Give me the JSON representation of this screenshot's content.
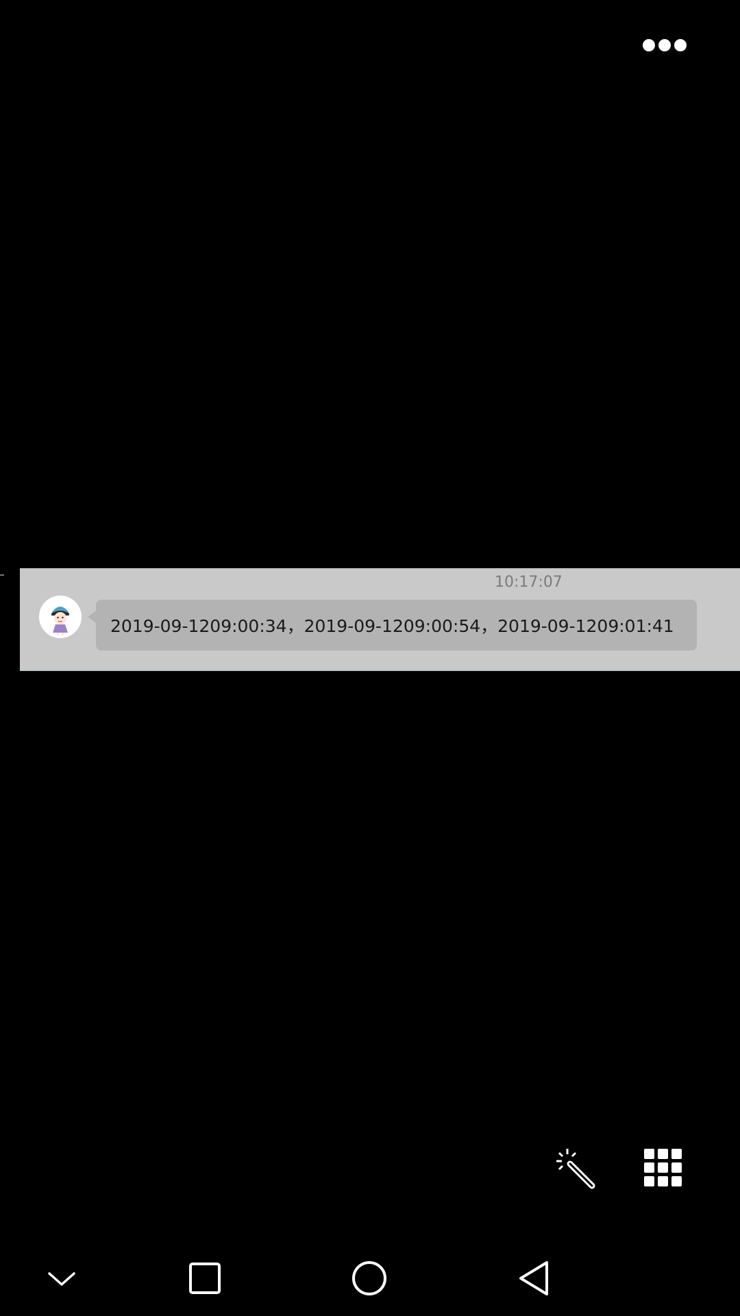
{
  "top_bar": {
    "more_icon": "more-horizontal-icon"
  },
  "image": {
    "timestamp": "10:17:07",
    "avatar_icon": "cartoon-girl-avatar",
    "message": "2019-09-1209:00:34，2019-09-1209:00:54，2019-09-1209:01:41",
    "strip_color": "#c9c9c9",
    "bubble_color": "#b3b3b3"
  },
  "tools": {
    "magic_icon": "magic-wand-icon",
    "grid_icon": "grid-icon"
  },
  "nav_bar": {
    "items": [
      "chevron-down-icon",
      "square-icon",
      "circle-icon",
      "triangle-back-icon"
    ]
  }
}
